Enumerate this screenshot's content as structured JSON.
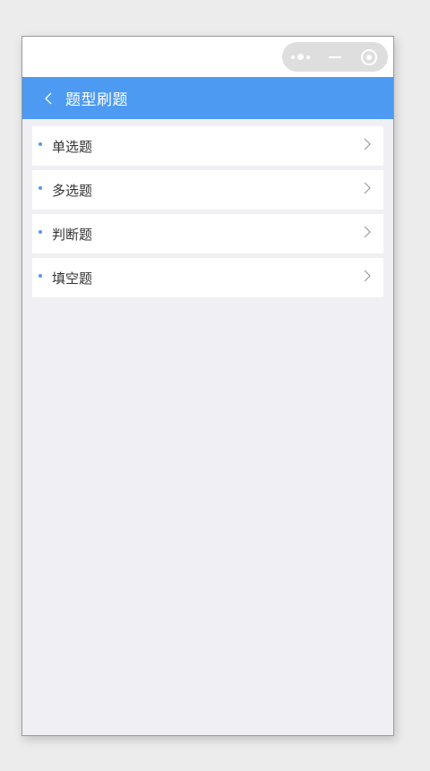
{
  "capsule": {
    "more_icon": "more-dots-icon",
    "minimize_icon": "minimize-icon",
    "close_icon": "close-circle-icon"
  },
  "navbar": {
    "back_icon": "chevron-left-icon",
    "title": "题型刷题",
    "background": "#4c9af2"
  },
  "list": {
    "items": [
      {
        "label": "单选题",
        "icon": "chevron-right-icon"
      },
      {
        "label": "多选题",
        "icon": "chevron-right-icon"
      },
      {
        "label": "判断题",
        "icon": "chevron-right-icon"
      },
      {
        "label": "填空题",
        "icon": "chevron-right-icon"
      }
    ]
  },
  "colors": {
    "accent": "#4c9af2",
    "page_background": "#efeff4",
    "row_background": "#ffffff"
  }
}
